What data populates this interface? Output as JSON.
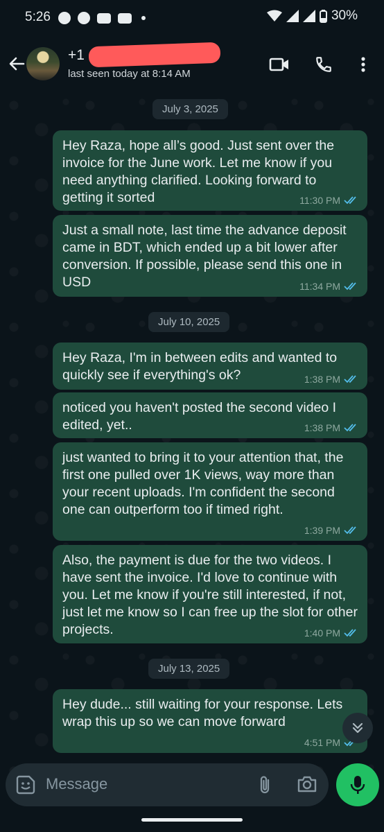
{
  "status_bar": {
    "time": "5:26",
    "battery": "30%"
  },
  "header": {
    "contact_name": "+1 (5",
    "last_seen": "last seen today at 8:14 AM"
  },
  "messages": [
    {
      "type": "date",
      "label": "July 3, 2025"
    },
    {
      "type": "out",
      "text": "Hey Raza, hope all’s good. Just sent over the invoice for the June work. Let me know if you need anything clarified. Looking forward to getting it sorted",
      "time": "11:30 PM"
    },
    {
      "type": "out",
      "text": "Just a small note, last time the advance deposit came in BDT, which ended up a bit lower after conversion. If possible, please send this one in USD",
      "time": "11:34 PM"
    },
    {
      "type": "date",
      "label": "July 10, 2025"
    },
    {
      "type": "out",
      "text": "Hey Raza, I'm in between edits and wanted to quickly see if everything's ok?",
      "time": "1:38 PM"
    },
    {
      "type": "out",
      "text": "noticed you haven't posted the second video I edited, yet..",
      "time": "1:38 PM"
    },
    {
      "type": "out",
      "text": "just wanted to bring it to your attention that, the first one pulled over 1K views, way more than your recent uploads. I'm confident the second one can outperform too if timed right.",
      "time": "1:39 PM"
    },
    {
      "type": "out",
      "text": "Also, the payment is due for the two videos. I have sent the invoice. I'd love to continue with you. Let me know if you're still interested, if not, just let me know so I can free up the slot for other projects.",
      "time": "1:40 PM"
    },
    {
      "type": "date",
      "label": "July 13, 2025"
    },
    {
      "type": "out",
      "text": "Hey dude... still waiting for your response. Lets wrap this up so we can move forward",
      "time": "4:51 PM"
    }
  ],
  "composer": {
    "placeholder": "Message"
  },
  "colors": {
    "accent": "#21c063",
    "outgoing_bubble": "#1f4b3c",
    "read_tick": "#53bdeb"
  }
}
